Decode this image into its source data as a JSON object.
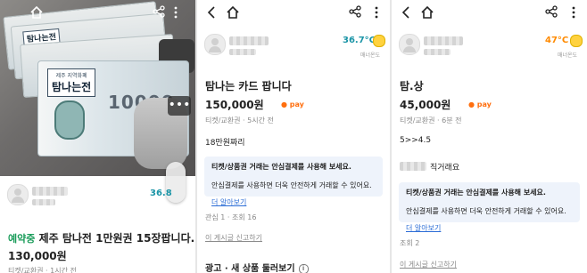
{
  "icons": {
    "back": "chevron-left",
    "home": "home",
    "share": "share",
    "more": "more-vertical"
  },
  "colors": {
    "accent": "#ff6f0f",
    "temp_teal": "#1a94a6",
    "temp_orange": "#ff8a00",
    "reserved": "#1a9c5a",
    "link": "#2a6cd6"
  },
  "panel1": {
    "photo": {
      "note_label_small": "제주 지역화폐",
      "note_label": "탐나는전",
      "note_denomination": "10000"
    },
    "seller": {
      "temperature": "36.8"
    },
    "listing": {
      "status": "예약중",
      "title": "제주 탐나전 1만원권 15장팝니다.",
      "price": "130,000원",
      "meta": "티켓/교환권 · 1시간 전"
    }
  },
  "panel2": {
    "seller": {
      "temperature": "36.7°C",
      "manner_label": "매너온도"
    },
    "listing": {
      "title": "탐나는 카드 팝니다",
      "price": "150,000원",
      "pay": "pay",
      "meta": "티켓/교환권 · 5시간 전",
      "body": "18만원짜리"
    },
    "safe_payment": {
      "title": "티켓/상품권 거래는 안심결제를 사용해 보세요.",
      "desc": "안심결제를 사용하면 더욱 안전하게 거래할 수 있어요.",
      "link": "더 알아보기"
    },
    "stats": "관심 1 · 조회 16",
    "report": "이 게시글 신고하기",
    "ads_heading": "광고 · 새 상품 둘러보기"
  },
  "panel3": {
    "seller": {
      "temperature": "47°C",
      "manner_label": "매너온도"
    },
    "listing": {
      "title": "탐.상",
      "price": "45,000원",
      "pay": "pay",
      "meta": "티켓/교환권 · 6분 전",
      "body1": "5>>4.5",
      "body2": "직거래요"
    },
    "safe_payment": {
      "title": "티켓/상품권 거래는 안심결제를 사용해 보세요.",
      "desc": "안심결제를 사용하면 더욱 안전하게 거래할 수 있어요.",
      "link": "더 알아보기"
    },
    "stats": "조회 2",
    "report": "이 게시글 신고하기"
  }
}
